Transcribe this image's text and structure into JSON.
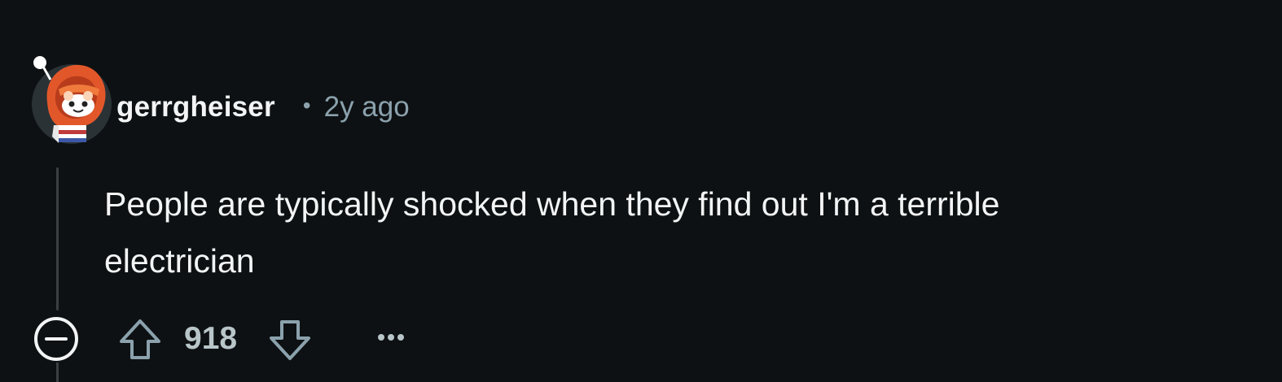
{
  "comment": {
    "username": "gerrgheiser",
    "separator": "•",
    "time_ago": "2y ago",
    "body_line1": "People are typically shocked when they find out I'm a terrible",
    "body_line2": "electrician",
    "score": "918"
  },
  "icons": {
    "avatar": "snoo-avatar-orange-hood",
    "collapse": "minus-circle-icon",
    "upvote": "arrow-up-icon",
    "downvote": "arrow-down-icon",
    "more": "ellipsis-icon"
  },
  "colors": {
    "background": "#0e1113",
    "text_primary": "#f2f4f5",
    "text_secondary": "#8ba2ad",
    "score_text": "#b8c5c9",
    "thread_line": "#3a3f42",
    "avatar_orange": "#e2572a"
  }
}
